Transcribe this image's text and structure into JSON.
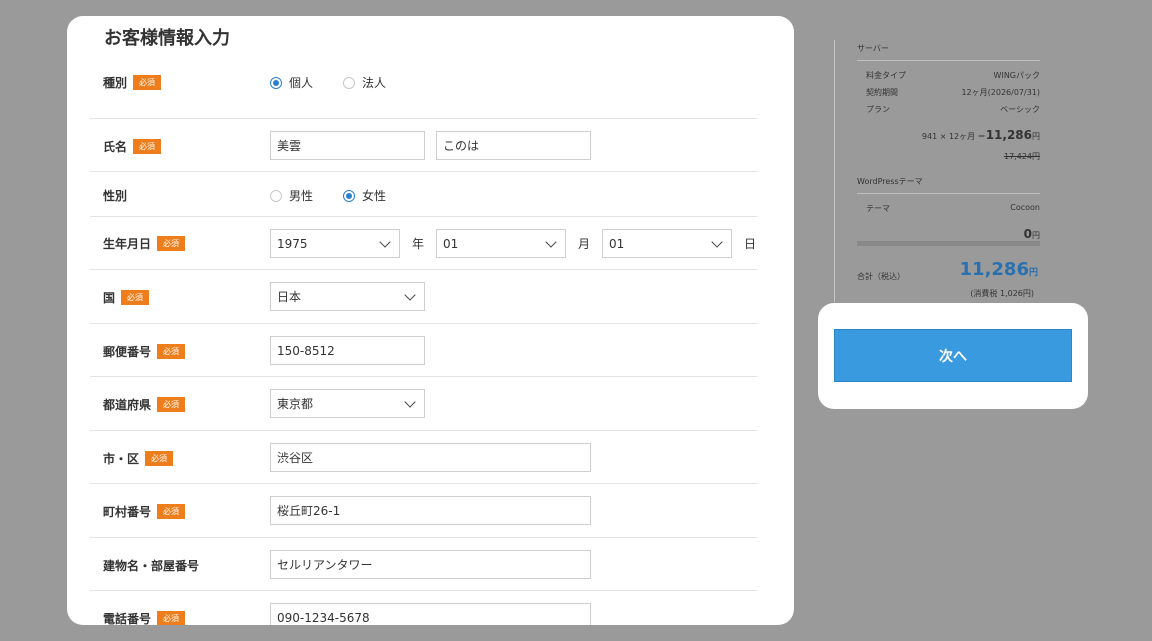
{
  "form_title": "お客様情報入力",
  "required_badge": "必須",
  "fields": {
    "type": {
      "label": "種別",
      "options": [
        "個人",
        "法人"
      ],
      "selected": "個人"
    },
    "name": {
      "label": "氏名",
      "last": "美雲",
      "first": "このは"
    },
    "gender": {
      "label": "性別",
      "options": [
        "男性",
        "女性"
      ],
      "selected": "女性"
    },
    "birthdate": {
      "label": "生年月日",
      "year": "1975",
      "year_unit": "年",
      "month": "01",
      "month_unit": "月",
      "day": "01",
      "day_unit": "日"
    },
    "country": {
      "label": "国",
      "value": "日本"
    },
    "postal": {
      "label": "郵便番号",
      "value": "150-8512"
    },
    "prefecture": {
      "label": "都道府県",
      "value": "東京都"
    },
    "city": {
      "label": "市・区",
      "value": "渋谷区"
    },
    "town": {
      "label": "町村番号",
      "value": "桜丘町26-1"
    },
    "building": {
      "label": "建物名・部屋番号",
      "value": "セルリアンタワー"
    },
    "phone": {
      "label": "電話番号",
      "value": "090-1234-5678"
    }
  },
  "summary": {
    "server_heading": "サーバー",
    "rows": [
      {
        "key": "料金タイプ",
        "value": "WINGパック"
      },
      {
        "key": "契約期間",
        "value": "12ヶ月(2026/07/31)"
      },
      {
        "key": "プラン",
        "value": "ベーシック"
      }
    ],
    "calc": "941 × 12ヶ月 ＝",
    "calc_total": "11,286",
    "yen": "円",
    "original_price": "17,424円",
    "theme_heading": "WordPressテーマ",
    "theme_key": "テーマ",
    "theme_value": "Cocoon",
    "theme_price": "0",
    "total_label": "合計（税込）",
    "total_value": "11,286",
    "tax_note": "(消費税 1,026円)"
  },
  "next_button": "次へ",
  "colors": {
    "accent": "#3a9ae0",
    "required": "#ee7d1b",
    "total": "#2a70ae"
  }
}
